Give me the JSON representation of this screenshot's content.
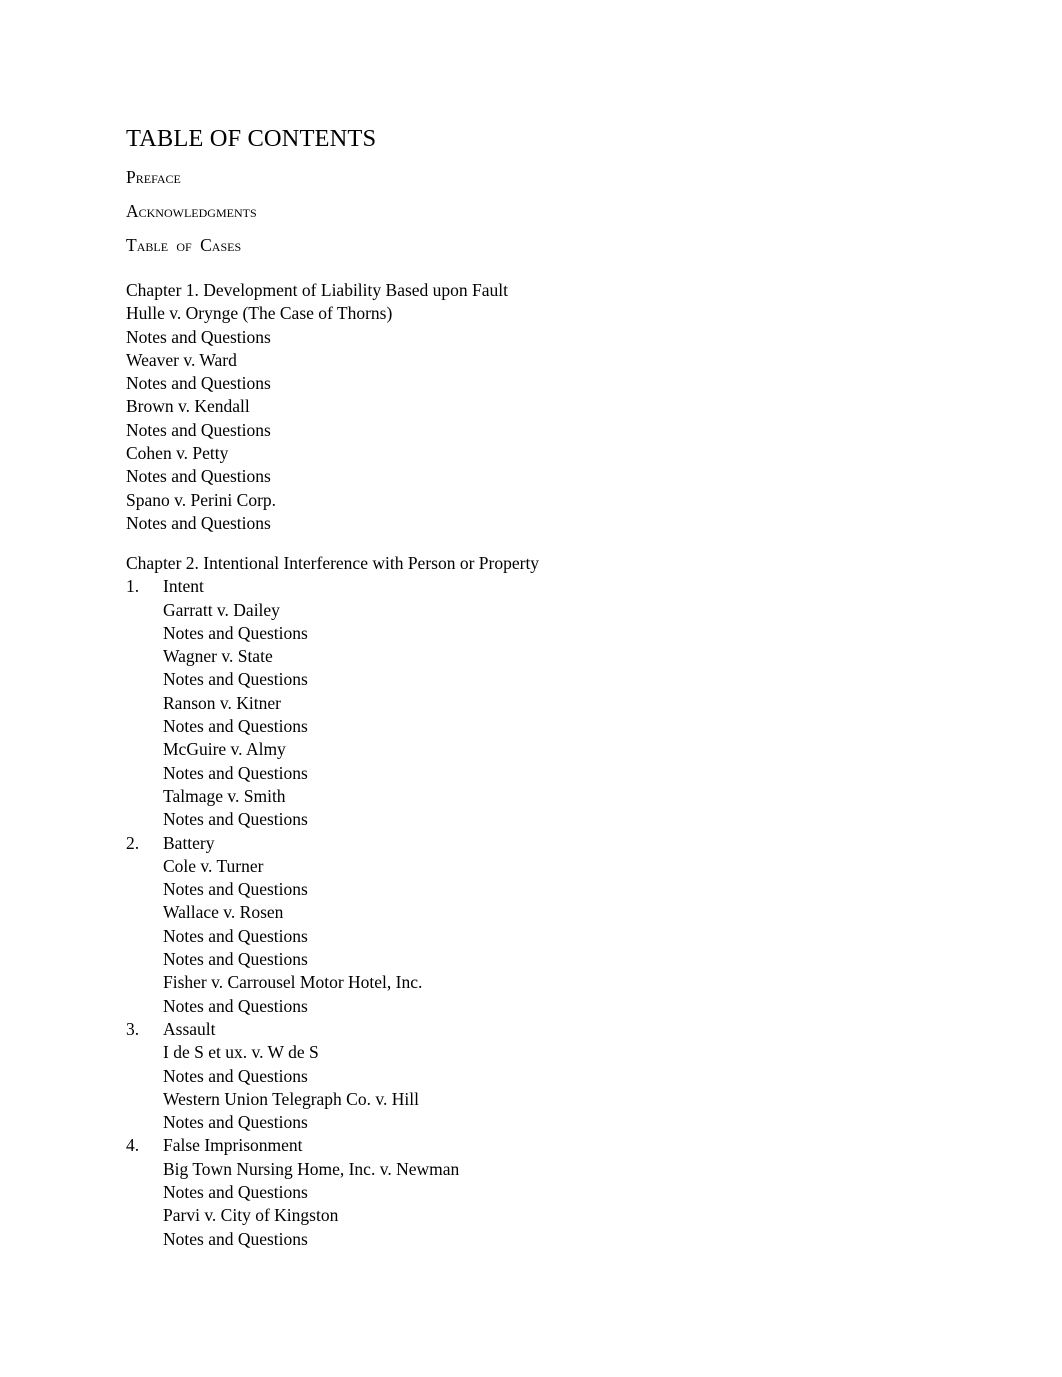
{
  "title": "TABLE OF CONTENTS",
  "front_matter": [
    "Preface",
    "Acknowledgments",
    "Table of Cases"
  ],
  "chapter1": {
    "heading": "Chapter 1. Development of Liability Based upon Fault",
    "items": [
      "Hulle v. Orynge (The Case of Thorns)",
      "Notes and Questions",
      "Weaver v. Ward",
      "Notes and Questions",
      "Brown v. Kendall",
      "Notes and Questions",
      "Cohen v. Petty",
      "Notes and Questions",
      "Spano v. Perini Corp.",
      "Notes and Questions"
    ]
  },
  "chapter2": {
    "heading": "Chapter 2. Intentional Interference with Person or Property",
    "sections": [
      {
        "number": "1.",
        "title": "Intent",
        "items": [
          "Garratt v. Dailey",
          "Notes and Questions",
          "Wagner v. State",
          "Notes and Questions",
          "Ranson v. Kitner",
          "Notes and Questions",
          "McGuire v. Almy",
          "Notes and Questions",
          "Talmage v. Smith",
          "Notes and Questions"
        ]
      },
      {
        "number": "2.",
        "title": "Battery",
        "items": [
          "Cole v. Turner",
          "Notes and Questions",
          "Wallace v. Rosen",
          "Notes and Questions",
          "Notes and Questions",
          "Fisher v. Carrousel Motor Hotel, Inc.",
          "Notes and Questions"
        ]
      },
      {
        "number": "3.",
        "title": "Assault",
        "items": [
          "I de S et ux. v. W de S",
          "Notes and Questions",
          "Western Union Telegraph Co. v. Hill",
          "Notes and Questions"
        ]
      },
      {
        "number": "4.",
        "title": "False Imprisonment",
        "items": [
          "Big Town Nursing Home, Inc. v. Newman",
          "Notes and Questions",
          "Parvi v. City of Kingston",
          "Notes and Questions"
        ]
      }
    ]
  }
}
